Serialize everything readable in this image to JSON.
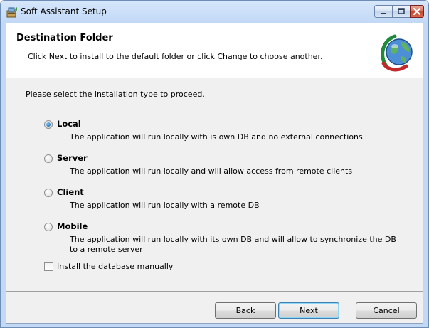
{
  "window": {
    "title": "Soft Assistant Setup",
    "controls": {
      "minimize_icon": "minimize-icon",
      "maximize_icon": "maximize-icon",
      "close_icon": "close-icon"
    },
    "accent_close": "#c24a32"
  },
  "banner": {
    "title": "Destination Folder",
    "description": "Click Next to install to the default folder or click Change to choose another.",
    "logo_icon": "globe-logo-icon"
  },
  "main": {
    "prompt": "Please select the installation type to proceed.",
    "options": [
      {
        "label": "Local",
        "description": "The application will run locally with is own DB and no external connections",
        "selected": true
      },
      {
        "label": "Server",
        "description": "The application will run locally and will allow access from remote clients",
        "selected": false
      },
      {
        "label": "Client",
        "description": "The application will run locally with a remote DB",
        "selected": false
      },
      {
        "label": "Mobile",
        "description": "The application will run locally with its own DB and will allow to synchronize the DB to a remote server",
        "selected": false
      }
    ],
    "manual_db": {
      "label": "Install the database manually",
      "checked": false
    }
  },
  "buttons": {
    "back": "Back",
    "next": "Next",
    "cancel": "Cancel"
  }
}
